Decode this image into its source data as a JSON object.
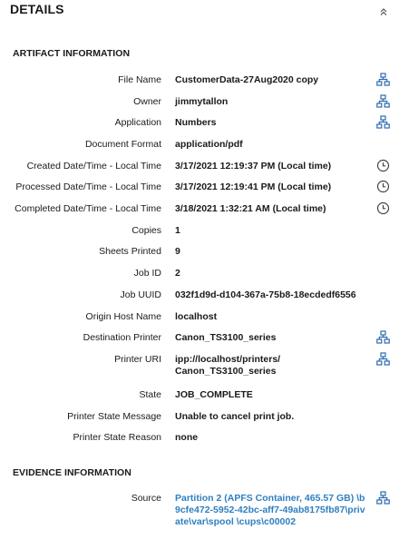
{
  "header": {
    "title": "DETAILS"
  },
  "artifact_section": {
    "title": "ARTIFACT INFORMATION"
  },
  "fields": [
    {
      "label": "File Name",
      "value": "CustomerData-27Aug2020 copy",
      "icon": "hierarchy-icon"
    },
    {
      "label": "Owner",
      "value": "jimmytallon",
      "icon": "hierarchy-icon"
    },
    {
      "label": "Application",
      "value": "Numbers",
      "icon": "hierarchy-icon"
    },
    {
      "label": "Document Format",
      "value": "application/pdf"
    },
    {
      "label": "Created Date/Time - Local Time",
      "value": "3/17/2021 12:19:37 PM (Local time)",
      "icon": "clock-icon"
    },
    {
      "label": "Processed Date/Time - Local Time",
      "value": "3/17/2021 12:19:41 PM (Local time)",
      "icon": "clock-icon"
    },
    {
      "label": "Completed Date/Time - Local Time",
      "value": "3/18/2021 1:32:21 AM (Local time)",
      "icon": "clock-icon"
    },
    {
      "label": "Copies",
      "value": "1"
    },
    {
      "label": "Sheets Printed",
      "value": "9"
    },
    {
      "label": "Job ID",
      "value": "2"
    },
    {
      "label": "Job UUID",
      "value": "032f1d9d-d104-367a-75b8-18ecdedf6556"
    },
    {
      "label": "Origin Host Name",
      "value": "localhost"
    },
    {
      "label": "Destination Printer",
      "value": "Canon_TS3100_series",
      "icon": "hierarchy-icon"
    },
    {
      "label": "Printer URI",
      "value": "ipp://localhost/printers/ Canon_TS3100_series",
      "icon": "hierarchy-icon"
    },
    {
      "label": "State",
      "value": "JOB_COMPLETE"
    },
    {
      "label": "Printer State Message",
      "value": "Unable to cancel print job."
    },
    {
      "label": "Printer State Reason",
      "value": "none"
    }
  ],
  "evidence_section": {
    "title": "EVIDENCE INFORMATION",
    "source_label": "Source",
    "source_value": "Partition 2 (APFS Container, 465.57 GB) \\b9cfe472-5952-42bc-aff7-49ab8175fb87\\private\\var\\spool \\cups\\c00002",
    "source_icon": "hierarchy-icon"
  },
  "colors": {
    "link": "#2e7fc1",
    "icon_blue": "#2b6cb0",
    "text": "#1a1a1a"
  }
}
